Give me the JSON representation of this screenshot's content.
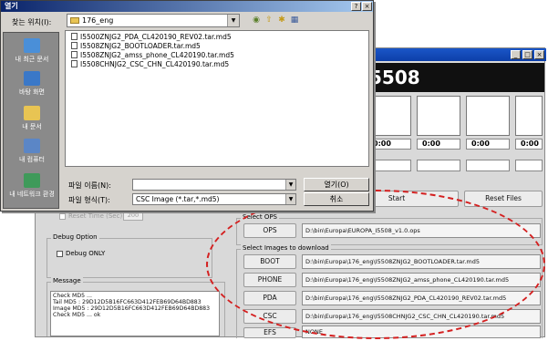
{
  "dialog": {
    "title": "열기",
    "look_in_label": "찾는 위치(I):",
    "look_in_value": "176_eng",
    "places": [
      "내 최근 문서",
      "바탕 화면",
      "내 문서",
      "내 컴퓨터",
      "내 네트워크 환경"
    ],
    "files": [
      "I5500ZNJG2_PDA_CL420190_REV02.tar.md5",
      "I5508ZNJG2_BOOTLOADER.tar.md5",
      "I5508ZNJG2_amss_phone_CL420190.tar.md5",
      "I5508CHNJG2_CSC_CHN_CL420190.tar.md5"
    ],
    "filename_label": "파일 이름(N):",
    "filename_value": "",
    "filetype_label": "파일 형식(T):",
    "filetype_value": "CSC Image (*.tar,*.md5)",
    "open_button": "열기(O)",
    "cancel_button": "취소"
  },
  "odin": {
    "model": "5508",
    "times": [
      "0:00",
      "0:00",
      "0:00",
      "0:00"
    ],
    "start_button": "Start",
    "reset_button": "Reset Files",
    "reset_time_label": "Reset Time (Sec)",
    "reset_time_value": "200",
    "debug_group": "Debug Option",
    "debug_only": "Debug ONLY",
    "message_group": "Message",
    "messages": [
      "Check MD5 ...",
      "Tail MD5 : 29D12D5B16FC663D412FEB69D64BD883",
      "Image MD5 : 29D12D5B16FC663D412FEB69D64BD883",
      "Check MD5 ... ok"
    ],
    "ops_group": "Select OPS",
    "ops_button": "OPS",
    "ops_path": "D:\\bin\\Europa\\EUROPA_I5508_v1.0.ops",
    "images_group": "Select Images to download",
    "images": [
      {
        "button": "BOOT",
        "path": "D:\\bin\\Europa\\176_eng\\I5508ZNJG2_BOOTLOADER.tar.md5"
      },
      {
        "button": "PHONE",
        "path": "D:\\bin\\Europa\\176_eng\\I5508ZNJG2_amss_phone_CL420190.tar.md5"
      },
      {
        "button": "PDA",
        "path": "D:\\bin\\Europa\\176_eng\\I5508ZNJG2_PDA_CL420190_REV02.tar.md5"
      },
      {
        "button": "CSC",
        "path": "D:\\bin\\Europa\\176_eng\\I5508CHNJG2_CSC_CHN_CL420190.tar.md5"
      },
      {
        "button": "EFS",
        "path": "NONE"
      }
    ]
  },
  "colors": {
    "annotation": "#d42020",
    "titlebar": "#0a246a",
    "banner": "#101010"
  }
}
